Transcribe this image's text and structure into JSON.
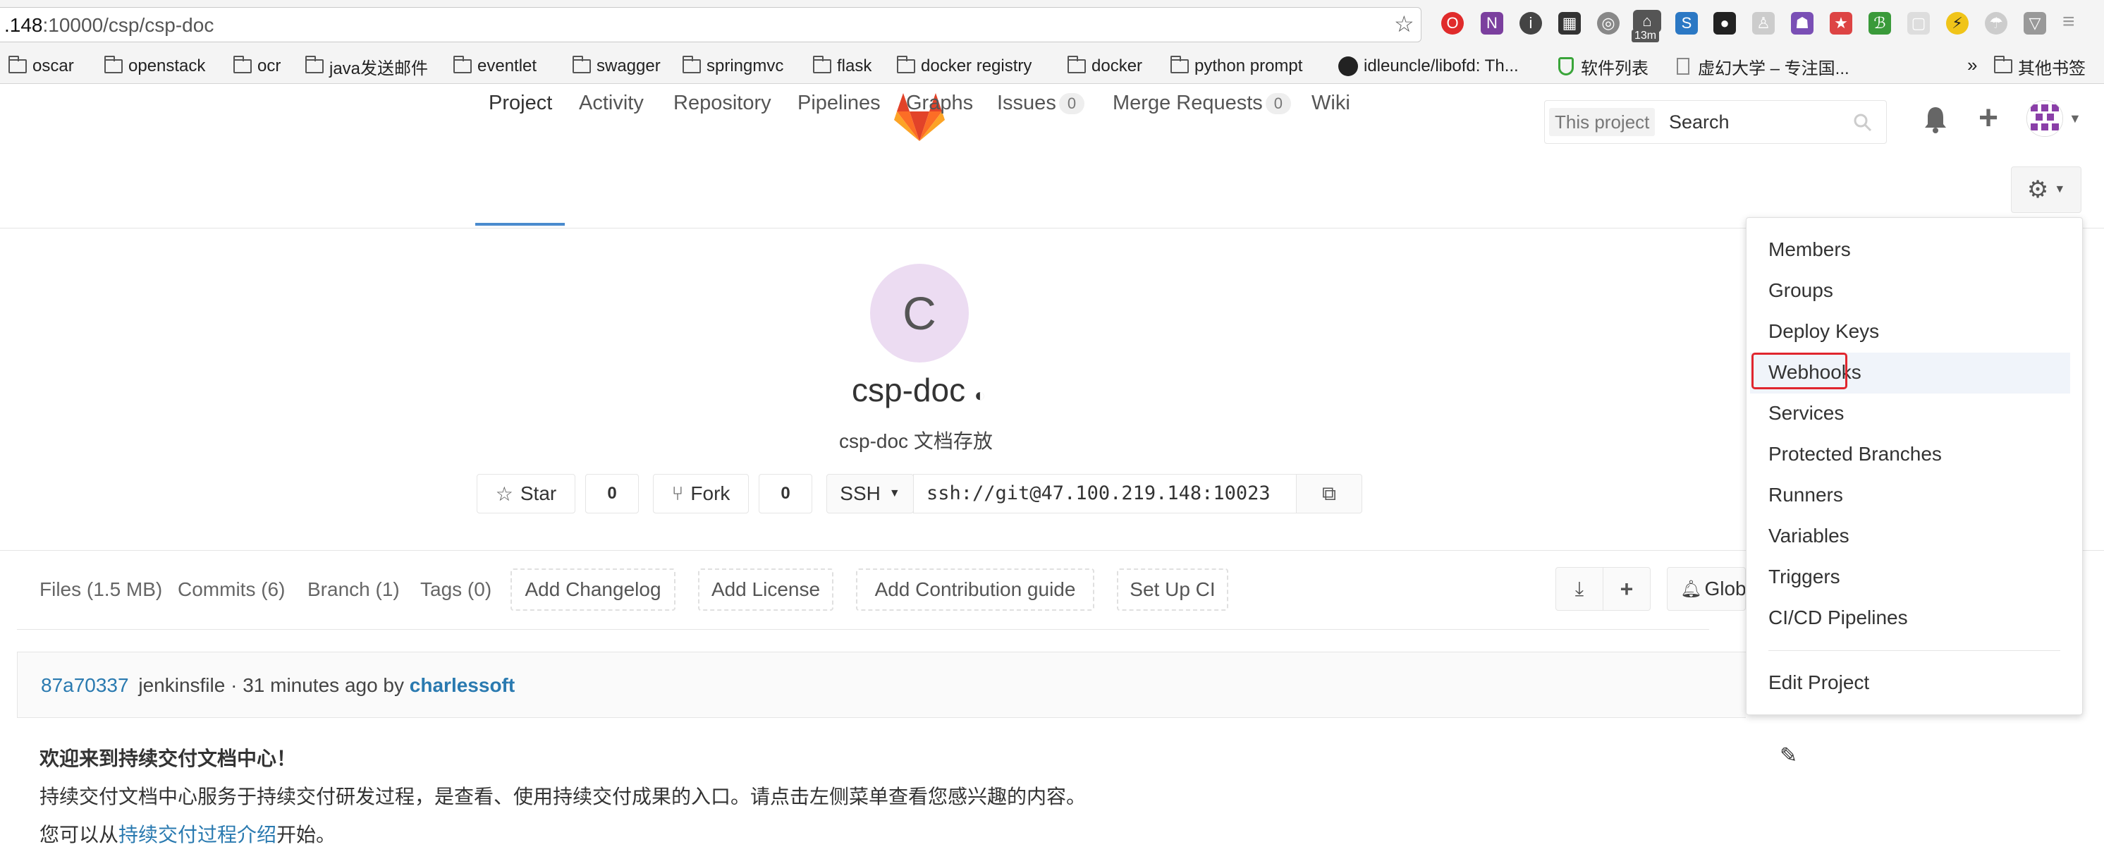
{
  "browser": {
    "url_prefix": ".148",
    "url_rest": ":10000/csp/csp-doc",
    "ext_badge": "13m",
    "bookmarks": [
      "oscar",
      "openstack",
      "ocr",
      "java发送邮件",
      "eventlet",
      "swagger",
      "springmvc",
      "flask",
      "docker registry",
      "docker",
      "python prompt",
      "idleuncle/libofd: Th...",
      "软件列表",
      "虚幻大学 – 专注国..."
    ],
    "overflow": "»",
    "other_bookmarks": "其他书签"
  },
  "header": {
    "search_scope": "This project",
    "search_placeholder": "Search",
    "tabs": [
      {
        "label": "Project"
      },
      {
        "label": "Activity"
      },
      {
        "label": "Repository"
      },
      {
        "label": "Pipelines"
      },
      {
        "label": "Graphs"
      },
      {
        "label": "Issues",
        "count": "0"
      },
      {
        "label": "Merge Requests",
        "count": "0"
      },
      {
        "label": "Wiki"
      }
    ]
  },
  "project": {
    "avatar_letter": "C",
    "name": "csp-doc",
    "description": "csp-doc 文档存放",
    "star_label": "Star",
    "star_count": "0",
    "fork_label": "Fork",
    "fork_count": "0",
    "protocol": "SSH",
    "clone_url": "ssh://git@47.100.219.148:10023"
  },
  "stats": {
    "files": "Files (1.5 MB)",
    "commits": "Commits (6)",
    "branch": "Branch (1)",
    "tags": "Tags (0)",
    "add_changelog": "Add Changelog",
    "add_license": "Add License",
    "add_contribution": "Add Contribution guide",
    "setup_ci": "Set Up CI",
    "notify_label": "Glob"
  },
  "commit": {
    "sha": "87a70337",
    "message": "jenkinsfile · 31 minutes ago by",
    "author": "charlessoft"
  },
  "readme": {
    "title": "欢迎来到持续交付文档中心！",
    "body": "持续交付文档中心服务于持续交付研发过程，是查看、使用持续交付成果的入口。请点击左侧菜单查看您感兴趣的内容。",
    "line3_prefix": "您可以从",
    "line3_link": "持续交付过程介绍",
    "line3_suffix": "开始。"
  },
  "settings_menu": {
    "items": [
      "Members",
      "Groups",
      "Deploy Keys",
      "Webhooks",
      "Services",
      "Protected Branches",
      "Runners",
      "Variables",
      "Triggers",
      "CI/CD Pipelines"
    ],
    "edit": "Edit Project",
    "highlighted": "Webhooks"
  },
  "colors": {
    "accent_link": "#2a7ab0",
    "highlight_border": "#e0262e",
    "avatar_bg": "#ecdcf2",
    "tab_underline": "#4a8bce"
  }
}
